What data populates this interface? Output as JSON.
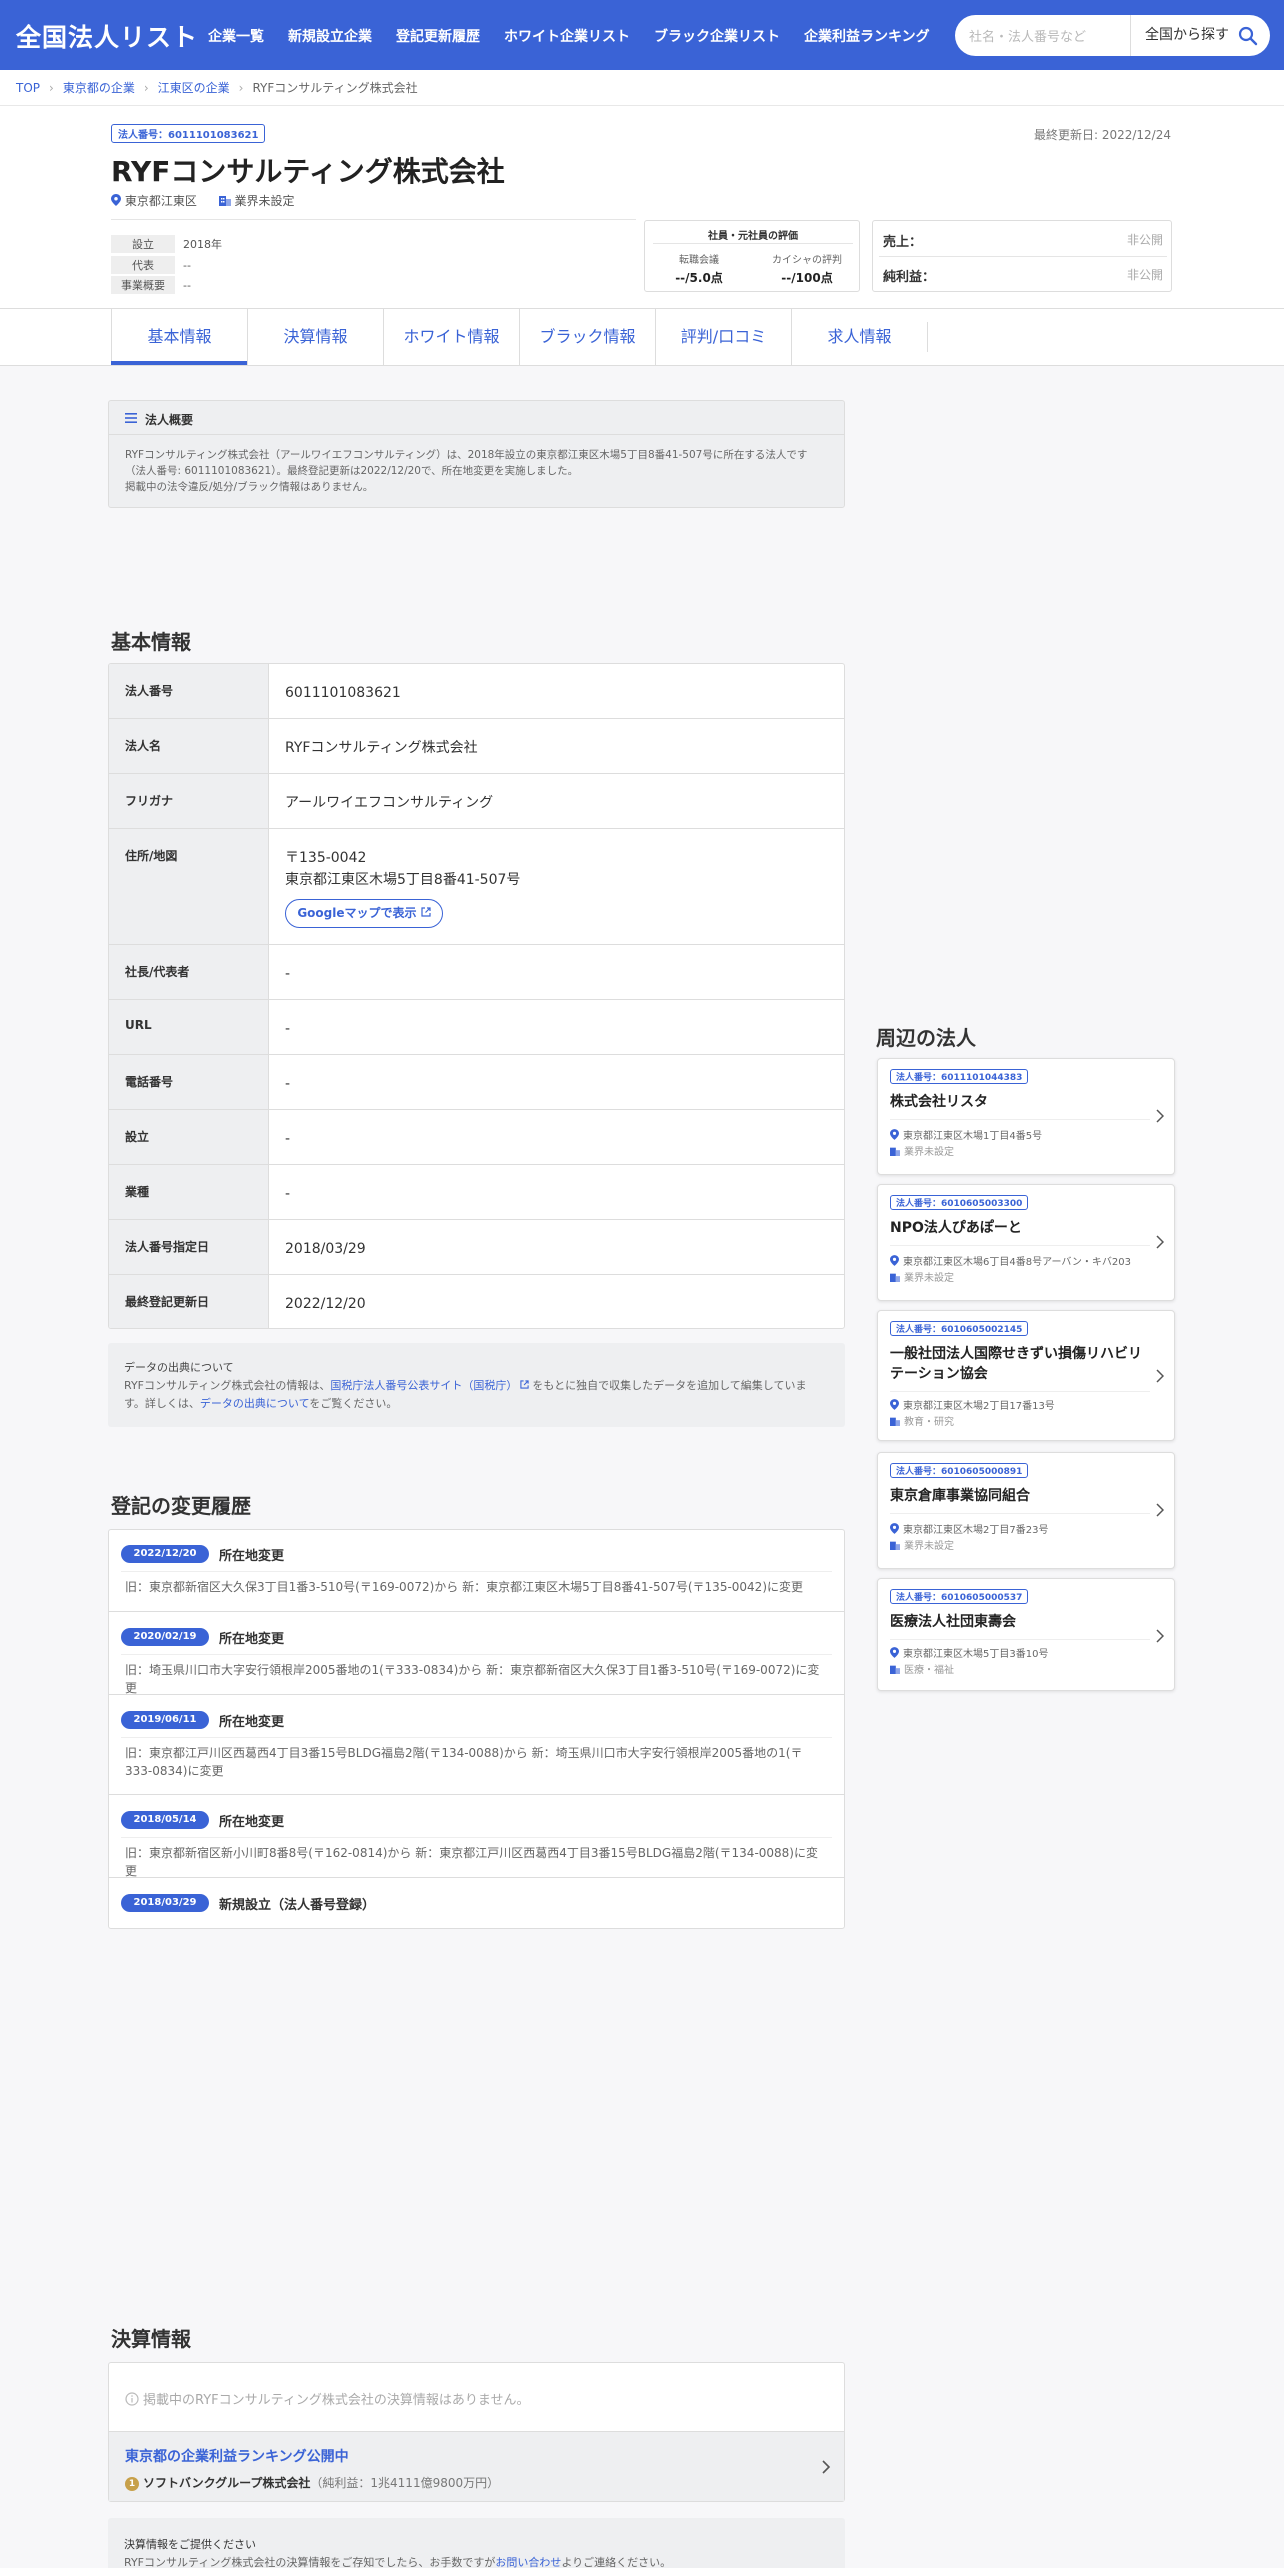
{
  "header": {
    "logo": "全国法人リスト",
    "nav": [
      "企業一覧",
      "新規設立企業",
      "登記更新履歴",
      "ホワイト企業リスト",
      "ブラック企業リスト",
      "企業利益ランキング"
    ],
    "search_placeholder": "社名・法人番号など",
    "search_scope": "全国から探す"
  },
  "breadcrumb": [
    "TOP",
    "東京都の企業",
    "江東区の企業",
    "RYFコンサルティング株式会社"
  ],
  "company": {
    "badge": "法人番号：6011101083621",
    "updated": "最終更新日: 2022/12/24",
    "name": "RYFコンサルティング株式会社",
    "location": "東京都江東区",
    "industry": "業界未設定",
    "founded_label": "設立",
    "founded": "2018年",
    "rep_label": "代表",
    "rep": "--",
    "business_label": "事業概要",
    "business": "--",
    "eval_title": "社員・元社員の評価",
    "eval1_label": "転職会議",
    "eval1_value": "--/5.0点",
    "eval2_label": "カイシャの評判",
    "eval2_value": "--/100点",
    "sales_label": "売上：",
    "sales_value": "非公開",
    "profit_label": "純利益：",
    "profit_value": "非公開"
  },
  "tabs": [
    "基本情報",
    "決算情報",
    "ホワイト情報",
    "ブラック情報",
    "評判/口コミ",
    "求人情報"
  ],
  "overview": {
    "title": "法人概要",
    "text": "RYFコンサルティング株式会社（アールワイエフコンサルティング）は、2018年設立の東京都江東区木場5丁目8番41-507号に所在する法人です（法人番号: 6011101083621）。最終登記更新は2022/12/20で、所在地変更を実施しました。",
    "text2": "掲載中の法令違反/処分/ブラック情報はありません。"
  },
  "basic": {
    "heading": "基本情報",
    "rows": [
      {
        "label": "法人番号",
        "value": "6011101083621"
      },
      {
        "label": "法人名",
        "value": "RYFコンサルティング株式会社"
      },
      {
        "label": "フリガナ",
        "value": "アールワイエフコンサルティング"
      },
      {
        "label": "住所/地図",
        "value": "〒135-0042",
        "value2": "東京都江東区木場5丁目8番41-507号",
        "button": "Googleマップで表示"
      },
      {
        "label": "社長/代表者",
        "value": "-"
      },
      {
        "label": "URL",
        "value": "-"
      },
      {
        "label": "電話番号",
        "value": "-"
      },
      {
        "label": "設立",
        "value": "-"
      },
      {
        "label": "業種",
        "value": "-"
      },
      {
        "label": "法人番号指定日",
        "value": "2018/03/29"
      },
      {
        "label": "最終登記更新日",
        "value": "2022/12/20"
      }
    ]
  },
  "source": {
    "title": "データの出典について",
    "text1": "RYFコンサルティング株式会社の情報は、",
    "link1": "国税庁法人番号公表サイト（国税庁）",
    "text2": "をもとに独自で収集したデータを追加して編集しています。詳しくは、",
    "link2": "データの出典について",
    "text3": "をご覧ください。"
  },
  "history": {
    "heading": "登記の変更履歴",
    "items": [
      {
        "date": "2022/12/20",
        "title": "所在地変更",
        "desc": "旧：東京都新宿区大久保3丁目1番3-510号(〒169-0072)から 新：東京都江東区木場5丁目8番41-507号(〒135-0042)に変更"
      },
      {
        "date": "2020/02/19",
        "title": "所在地変更",
        "desc": "旧：埼玉県川口市大字安行領根岸2005番地の1(〒333-0834)から 新：東京都新宿区大久保3丁目1番3-510号(〒169-0072)に変更"
      },
      {
        "date": "2019/06/11",
        "title": "所在地変更",
        "desc": "旧：東京都江戸川区西葛西4丁目3番15号BLDG福島2階(〒134-0088)から 新：埼玉県川口市大字安行領根岸2005番地の1(〒333-0834)に変更"
      },
      {
        "date": "2018/05/14",
        "title": "所在地変更",
        "desc": "旧：東京都新宿区新小川町8番8号(〒162-0814)から 新：東京都江戸川区西葛西4丁目3番15号BLDG福島2階(〒134-0088)に変更"
      },
      {
        "date": "2018/03/29",
        "title": "新規設立（法人番号登録）",
        "desc": ""
      }
    ]
  },
  "settlement": {
    "heading": "決算情報",
    "message": "掲載中のRYFコンサルティング株式会社の決算情報はありません。",
    "ranking_title": "東京都の企業利益ランキング公開中",
    "rank_no": "1",
    "rank_company": "ソフトバンクグループ株式会社",
    "rank_note": "（純利益：1兆4111億9800万円）",
    "provide_title": "決算情報をご提供ください",
    "provide_text": "RYFコンサルティング株式会社の決算情報をご存知でしたら、お手数ですが",
    "provide_link": "お問い合わせ",
    "provide_text2": "よりご連絡ください。"
  },
  "nearby": {
    "heading": "周辺の法人",
    "cards": [
      {
        "badge": "法人番号：6011101044383",
        "name": "株式会社リスタ",
        "addr": "東京都江東区木場1丁目4番5号",
        "industry": "業界未設定"
      },
      {
        "badge": "法人番号：6010605003300",
        "name": "NPO法人ぴあぽーと",
        "addr": "東京都江東区木場6丁目4番8号アーバン・キバ203",
        "industry": "業界未設定"
      },
      {
        "badge": "法人番号：6010605002145",
        "name": "一般社団法人国際せきずい損傷リハビリテーション協会",
        "addr": "東京都江東区木場2丁目17番13号",
        "industry": "教育・研究"
      },
      {
        "badge": "法人番号：6010605000891",
        "name": "東京倉庫事業協同組合",
        "addr": "東京都江東区木場2丁目7番23号",
        "industry": "業界未設定"
      },
      {
        "badge": "法人番号：6010605000537",
        "name": "医療法人社団東壽会",
        "addr": "東京都江東区木場5丁目3番10号",
        "industry": "医療・福祉"
      }
    ]
  },
  "colors": {
    "primary": "#3a63d6",
    "accent_gold": "#c7a04a"
  }
}
